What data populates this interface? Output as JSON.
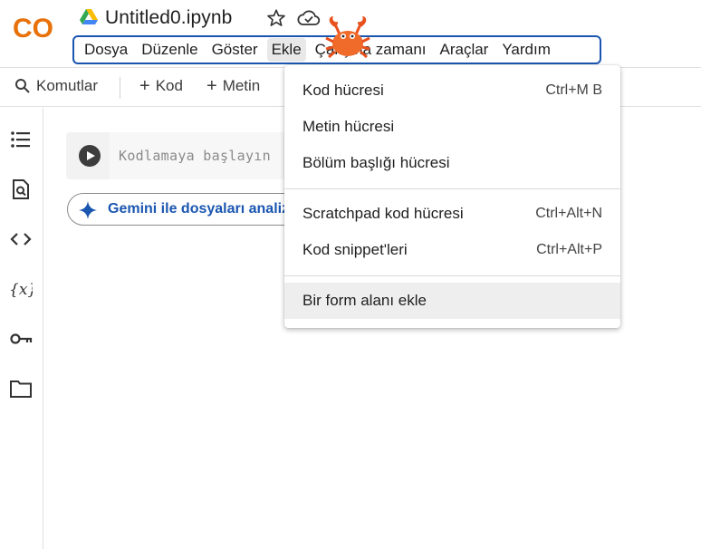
{
  "header": {
    "title": "Untitled0.ipynb",
    "logo_text": "CO"
  },
  "menubar": {
    "items": [
      "Dosya",
      "Düzenle",
      "Göster",
      "Ekle",
      "Çalışma zamanı",
      "Araçlar",
      "Yardım"
    ],
    "active": "Ekle"
  },
  "toolbar": {
    "commands_label": "Komutlar",
    "add_code_label": "Kod",
    "add_text_label": "Metin"
  },
  "cell": {
    "placeholder": "Kodlamaya başlayın"
  },
  "gemini": {
    "label": "Gemini ile dosyaları analiz et"
  },
  "dropdown": {
    "items": [
      {
        "label": "Kod hücresi",
        "shortcut": "Ctrl+M B"
      },
      {
        "label": "Metin hücresi",
        "shortcut": ""
      },
      {
        "label": "Bölüm başlığı hücresi",
        "shortcut": ""
      },
      {
        "label": "Scratchpad kod hücresi",
        "shortcut": "Ctrl+Alt+N"
      },
      {
        "label": "Kod snippet'leri",
        "shortcut": "Ctrl+Alt+P"
      },
      {
        "label": "Bir form alanı ekle",
        "shortcut": ""
      }
    ],
    "hovered": "Bir form alanı ekle"
  },
  "sidebar": {
    "icons": [
      "table-of-contents-icon",
      "find-icon",
      "code-snippets-icon",
      "variables-icon",
      "secrets-key-icon",
      "files-folder-icon"
    ]
  },
  "colors": {
    "accent": "#1a56b0",
    "logo_orange": "#f9ab00",
    "logo_dark_orange": "#e8710a"
  }
}
